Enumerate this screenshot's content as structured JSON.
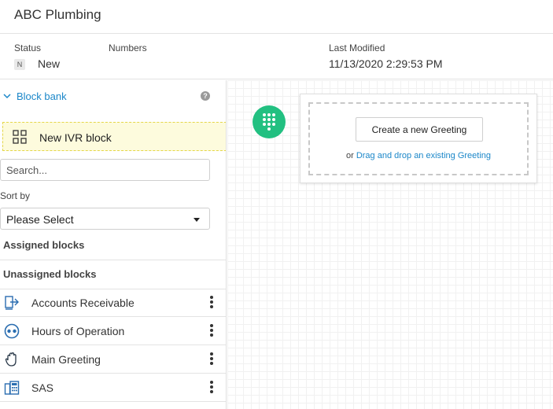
{
  "header": {
    "title": "ABC Plumbing"
  },
  "meta": {
    "status_label": "Status",
    "status_badge": "N",
    "status_value": "New",
    "numbers_label": "Numbers",
    "modified_label": "Last Modified",
    "modified_value": "11/13/2020 2:29:53 PM"
  },
  "sidebar": {
    "block_bank_title": "Block bank",
    "help_icon": "?",
    "new_block_label": "New IVR block",
    "search_placeholder": "Search...",
    "sort_label": "Sort by",
    "sort_value": "Please Select",
    "assigned_title": "Assigned blocks",
    "unassigned_title": "Unassigned blocks",
    "blocks": [
      {
        "label": "Accounts Receivable",
        "icon": "transfer-icon"
      },
      {
        "label": "Hours of Operation",
        "icon": "hours-icon"
      },
      {
        "label": "Main Greeting",
        "icon": "greeting-hand-icon"
      },
      {
        "label": "SAS",
        "icon": "phone-directory-icon"
      }
    ]
  },
  "canvas": {
    "start_node_icon": "keypad-icon",
    "create_button": "Create a new Greeting",
    "or_text": "or",
    "drag_link": "Drag and drop an existing Greeting"
  },
  "colors": {
    "accent_blue": "#1b87c9",
    "start_green": "#22c081",
    "new_block_bg": "#fdfbdd"
  }
}
